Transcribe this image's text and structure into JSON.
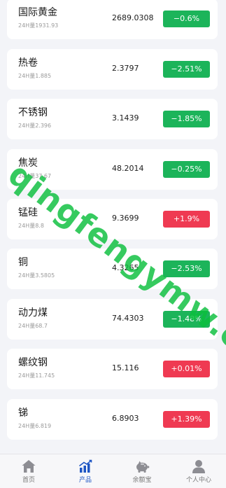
{
  "colors": {
    "up": "#ef3a52",
    "down": "#1cb45a",
    "accent": "#1d55c4",
    "tab_gray": "#8d8d93"
  },
  "products": [
    {
      "name": "国际黄金",
      "volume": "24H量1931.93",
      "price": "2689.0308",
      "change": "−0.6%",
      "direction": "down"
    },
    {
      "name": "热卷",
      "volume": "24H量1.885",
      "price": "2.3797",
      "change": "−2.51%",
      "direction": "down"
    },
    {
      "name": "不锈钢",
      "volume": "24H量2.396",
      "price": "3.1439",
      "change": "−1.85%",
      "direction": "down"
    },
    {
      "name": "焦炭",
      "volume": "24H量37.67",
      "price": "48.2014",
      "change": "−0.25%",
      "direction": "down"
    },
    {
      "name": "锰硅",
      "volume": "24H量8.8",
      "price": "9.3699",
      "change": "+1.9%",
      "direction": "up"
    },
    {
      "name": "铜",
      "volume": "24H量3.5805",
      "price": "4.3265",
      "change": "−2.53%",
      "direction": "down"
    },
    {
      "name": "动力煤",
      "volume": "24H量68.7",
      "price": "74.4303",
      "change": "−1.48%",
      "direction": "down"
    },
    {
      "name": "螺纹钢",
      "volume": "24H量11.745",
      "price": "15.116",
      "change": "+0.01%",
      "direction": "up"
    },
    {
      "name": "锑",
      "volume": "24H量6.819",
      "price": "6.8903",
      "change": "+1.39%",
      "direction": "up"
    }
  ],
  "watermark": "qingfengymw.com",
  "tabs": [
    {
      "label": "首页",
      "icon": "home-icon",
      "active": false
    },
    {
      "label": "产品",
      "icon": "bar-chart-icon",
      "active": true
    },
    {
      "label": "余额宝",
      "icon": "piggy-bank-icon",
      "active": false
    },
    {
      "label": "个人中心",
      "icon": "user-icon",
      "active": false
    }
  ]
}
